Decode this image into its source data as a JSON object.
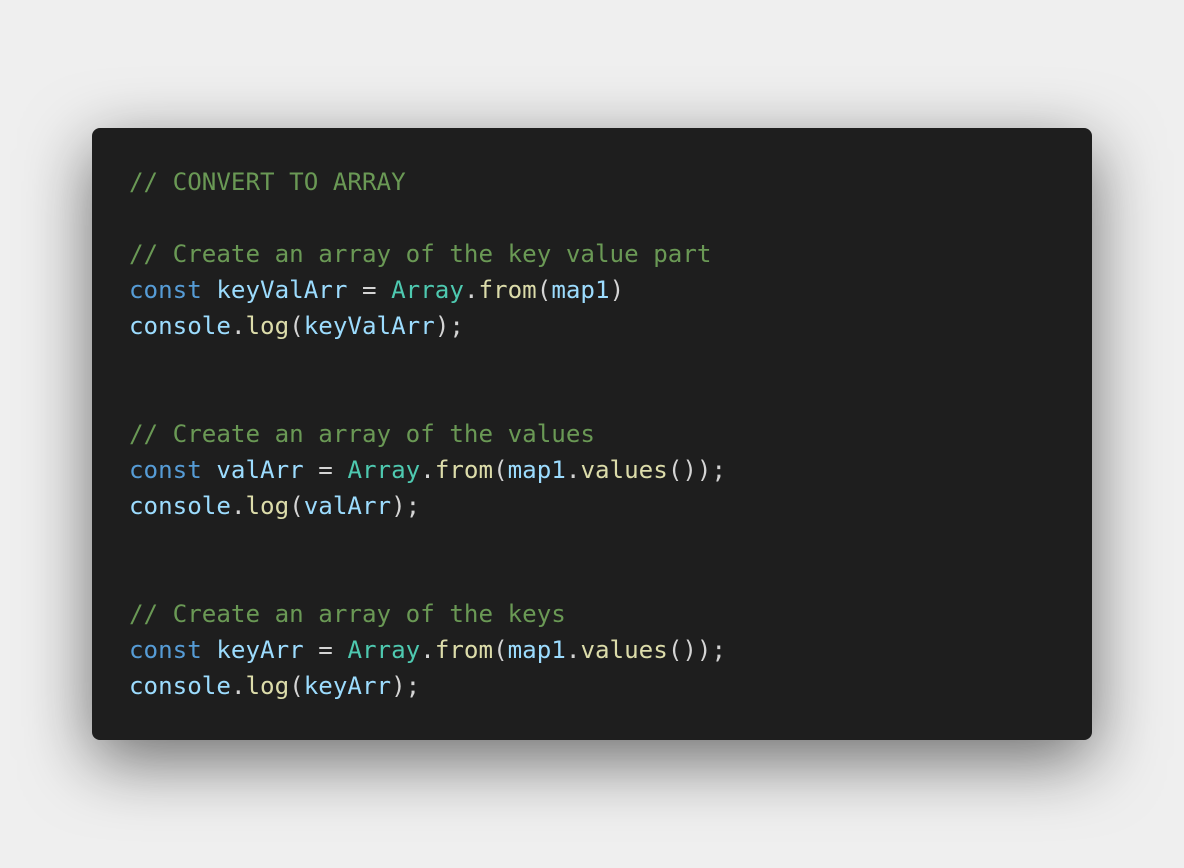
{
  "editor": {
    "lines": [
      [
        {
          "t": "// CONVERT TO ARRAY",
          "k": "comment"
        }
      ],
      [],
      [
        {
          "t": "// Create an array of the key value part",
          "k": "comment"
        }
      ],
      [
        {
          "t": "const",
          "k": "keyword"
        },
        {
          "t": " ",
          "k": "punct"
        },
        {
          "t": "keyValArr",
          "k": "variable"
        },
        {
          "t": " = ",
          "k": "punct"
        },
        {
          "t": "Array",
          "k": "class"
        },
        {
          "t": ".",
          "k": "punct"
        },
        {
          "t": "from",
          "k": "function"
        },
        {
          "t": "(",
          "k": "punct"
        },
        {
          "t": "map1",
          "k": "variable"
        },
        {
          "t": ")",
          "k": "punct"
        }
      ],
      [
        {
          "t": "console",
          "k": "variable"
        },
        {
          "t": ".",
          "k": "punct"
        },
        {
          "t": "log",
          "k": "function"
        },
        {
          "t": "(",
          "k": "punct"
        },
        {
          "t": "keyValArr",
          "k": "variable"
        },
        {
          "t": ");",
          "k": "punct"
        }
      ],
      [],
      [],
      [
        {
          "t": "// Create an array of the values",
          "k": "comment"
        }
      ],
      [
        {
          "t": "const",
          "k": "keyword"
        },
        {
          "t": " ",
          "k": "punct"
        },
        {
          "t": "valArr",
          "k": "variable"
        },
        {
          "t": " = ",
          "k": "punct"
        },
        {
          "t": "Array",
          "k": "class"
        },
        {
          "t": ".",
          "k": "punct"
        },
        {
          "t": "from",
          "k": "function"
        },
        {
          "t": "(",
          "k": "punct"
        },
        {
          "t": "map1",
          "k": "variable"
        },
        {
          "t": ".",
          "k": "punct"
        },
        {
          "t": "values",
          "k": "function"
        },
        {
          "t": "());",
          "k": "punct"
        }
      ],
      [
        {
          "t": "console",
          "k": "variable"
        },
        {
          "t": ".",
          "k": "punct"
        },
        {
          "t": "log",
          "k": "function"
        },
        {
          "t": "(",
          "k": "punct"
        },
        {
          "t": "valArr",
          "k": "variable"
        },
        {
          "t": ");",
          "k": "punct"
        }
      ],
      [],
      [],
      [
        {
          "t": "// Create an array of the keys",
          "k": "comment"
        }
      ],
      [
        {
          "t": "const",
          "k": "keyword"
        },
        {
          "t": " ",
          "k": "punct"
        },
        {
          "t": "keyArr",
          "k": "variable"
        },
        {
          "t": " = ",
          "k": "punct"
        },
        {
          "t": "Array",
          "k": "class"
        },
        {
          "t": ".",
          "k": "punct"
        },
        {
          "t": "from",
          "k": "function"
        },
        {
          "t": "(",
          "k": "punct"
        },
        {
          "t": "map1",
          "k": "variable"
        },
        {
          "t": ".",
          "k": "punct"
        },
        {
          "t": "values",
          "k": "function"
        },
        {
          "t": "());",
          "k": "punct"
        }
      ],
      [
        {
          "t": "console",
          "k": "variable"
        },
        {
          "t": ".",
          "k": "punct"
        },
        {
          "t": "log",
          "k": "function"
        },
        {
          "t": "(",
          "k": "punct"
        },
        {
          "t": "keyArr",
          "k": "variable"
        },
        {
          "t": ");",
          "k": "punct"
        }
      ]
    ]
  },
  "colors": {
    "page_background": "#efefef",
    "editor_background": "#1e1e1e",
    "comment": "#6a9955",
    "keyword": "#569cd6",
    "variable": "#9cdcfe",
    "class": "#4ec9b0",
    "function": "#dcdcaa",
    "punctuation": "#d4d4d4"
  }
}
